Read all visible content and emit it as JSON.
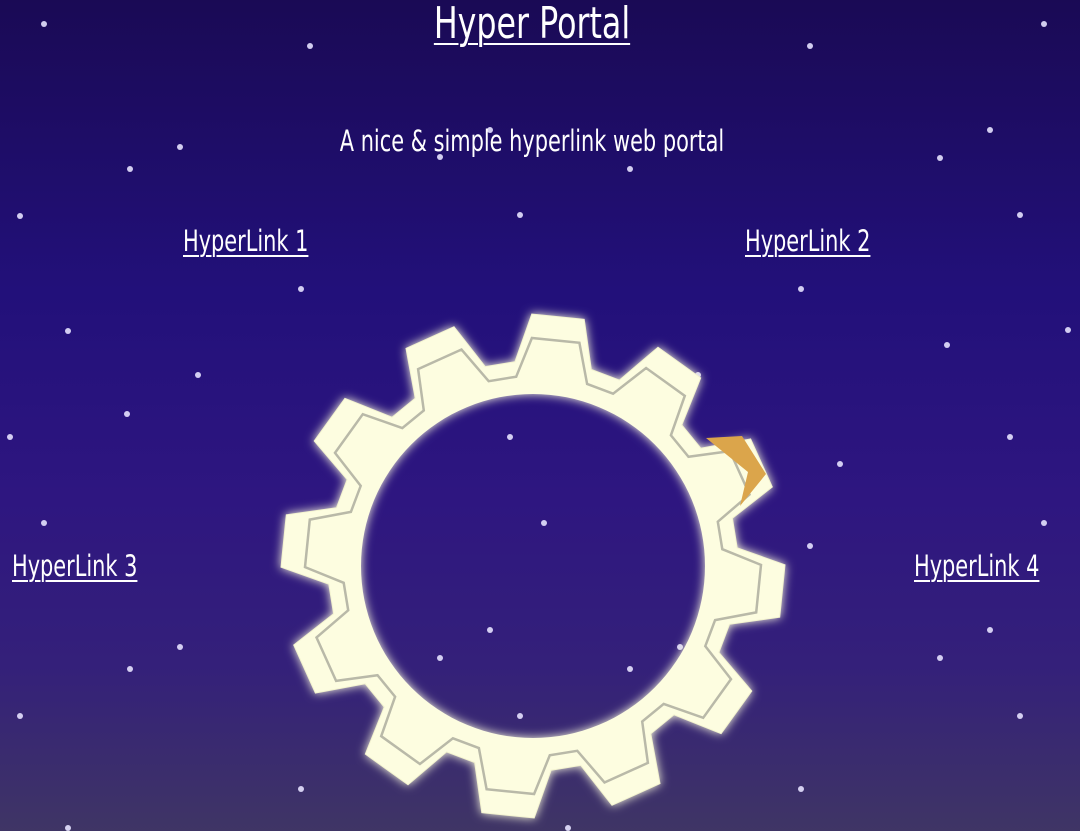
{
  "page": {
    "title": "Hyper Portal",
    "subtitle": "A nice & simple hyperlink web portal"
  },
  "links": [
    {
      "label": "HyperLink 1"
    },
    {
      "label": "HyperLink 2"
    },
    {
      "label": "HyperLink 3"
    },
    {
      "label": "HyperLink 4"
    }
  ],
  "portal": {
    "icon": "gear-portal-icon",
    "gear_fill": "#fdfde0",
    "accent": "#dba54b"
  },
  "colors": {
    "background_top": "#1a0a55",
    "background_bottom": "#3f3565",
    "star": "#e8e4ff",
    "text": "#ffffff"
  }
}
